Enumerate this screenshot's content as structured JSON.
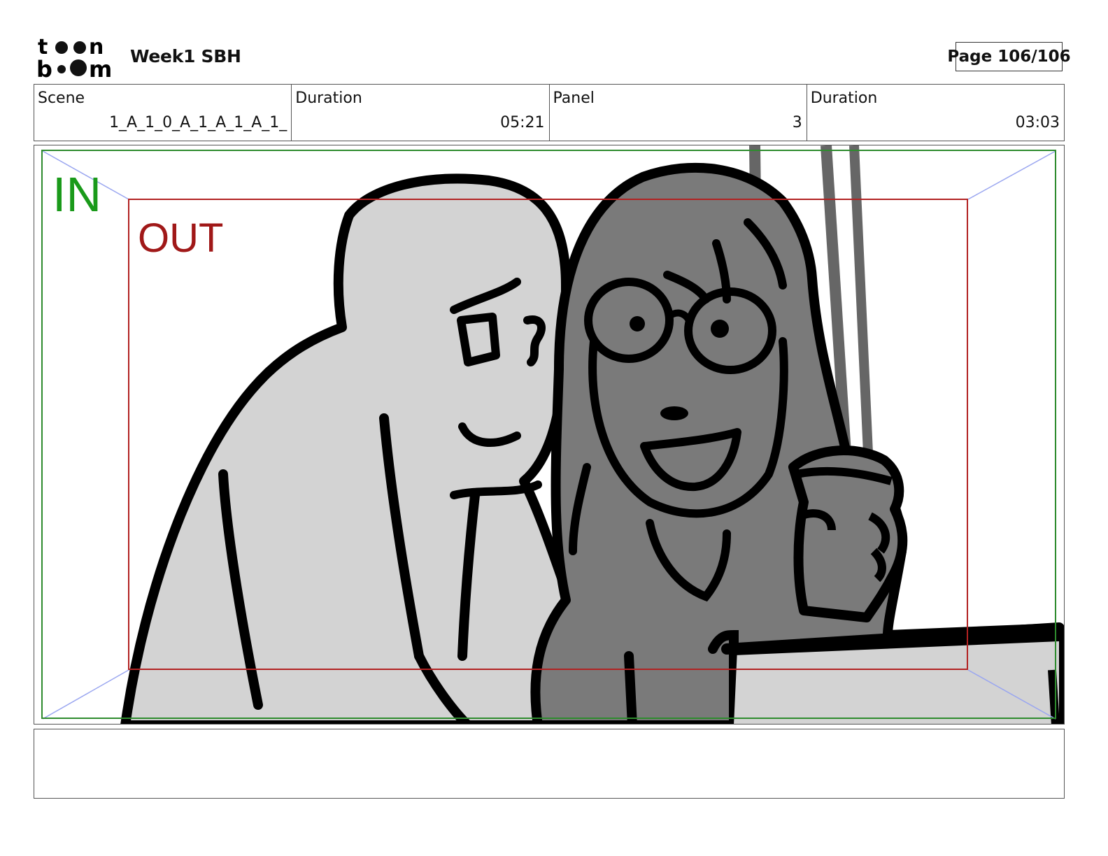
{
  "header": {
    "logo_text": "toon boom",
    "project_title": "Week1 SBH",
    "page_label": "Page 106/106"
  },
  "info": {
    "scene_label": "Scene",
    "scene_value": "1_A_1_0_A_1_A_1_A_1_",
    "scene_duration_label": "Duration",
    "scene_duration_value": "05:21",
    "panel_label": "Panel",
    "panel_value": "3",
    "panel_duration_label": "Duration",
    "panel_duration_value": "03:03"
  },
  "panel": {
    "in_label": "IN",
    "out_label": "OUT",
    "colors": {
      "in_frame": "#2e8b2e",
      "out_frame": "#b22222",
      "guide_lines": "#9aa6f0",
      "character_light": "#d3d3d3",
      "character_dark": "#7a7a7a",
      "ink": "#000000"
    }
  },
  "notes": {
    "text": ""
  }
}
